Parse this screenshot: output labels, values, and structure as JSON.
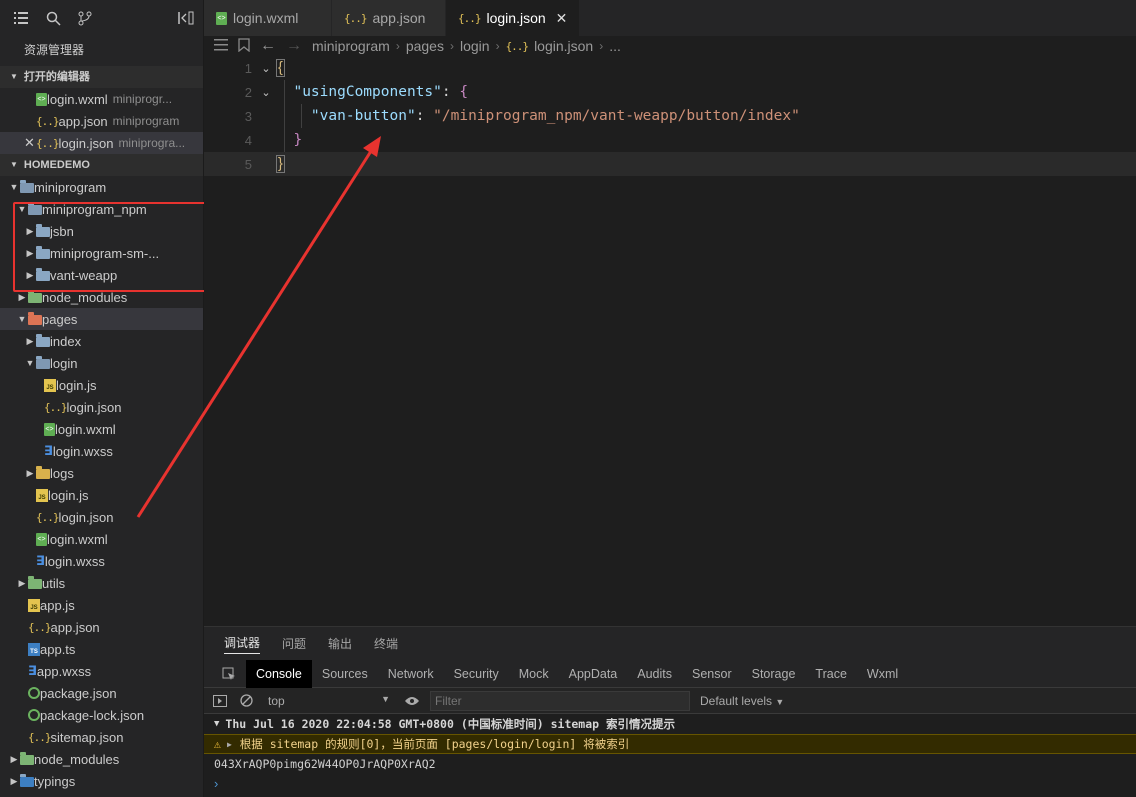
{
  "sidebar": {
    "title": "资源管理器",
    "open_editors": {
      "heading": "打开的编辑器",
      "items": [
        {
          "name": "login.wxml",
          "desc": "miniprogr...",
          "type": "wxml"
        },
        {
          "name": "app.json",
          "desc": "miniprogram",
          "type": "json"
        },
        {
          "name": "login.json",
          "desc": "miniprogra...",
          "type": "json",
          "active": true
        }
      ]
    },
    "project": {
      "heading": "HOMEDEMO",
      "tree": [
        {
          "label": "miniprogram",
          "depth": 1,
          "kind": "folder-open",
          "twisty": "open"
        },
        {
          "label": "miniprogram_npm",
          "depth": 2,
          "kind": "folder-open",
          "twisty": "open"
        },
        {
          "label": "jsbn",
          "depth": 3,
          "kind": "folder",
          "twisty": "closed"
        },
        {
          "label": "miniprogram-sm-...",
          "depth": 3,
          "kind": "folder",
          "twisty": "closed"
        },
        {
          "label": "vant-weapp",
          "depth": 3,
          "kind": "folder",
          "twisty": "closed"
        },
        {
          "label": "node_modules",
          "depth": 2,
          "kind": "folder-green",
          "twisty": "closed"
        },
        {
          "label": "pages",
          "depth": 2,
          "kind": "folder-pages",
          "twisty": "open",
          "selected": true
        },
        {
          "label": "index",
          "depth": 3,
          "kind": "folder",
          "twisty": "closed"
        },
        {
          "label": "login",
          "depth": 3,
          "kind": "folder-open",
          "twisty": "open"
        },
        {
          "label": "login.js",
          "depth": 4,
          "kind": "js"
        },
        {
          "label": "login.json",
          "depth": 4,
          "kind": "json"
        },
        {
          "label": "login.wxml",
          "depth": 4,
          "kind": "wxml"
        },
        {
          "label": "login.wxss",
          "depth": 4,
          "kind": "wxss"
        },
        {
          "label": "logs",
          "depth": 3,
          "kind": "folder-logs",
          "twisty": "closed"
        },
        {
          "label": "login.js",
          "depth": 3,
          "kind": "js"
        },
        {
          "label": "login.json",
          "depth": 3,
          "kind": "json"
        },
        {
          "label": "login.wxml",
          "depth": 3,
          "kind": "wxml"
        },
        {
          "label": "login.wxss",
          "depth": 3,
          "kind": "wxss"
        },
        {
          "label": "utils",
          "depth": 2,
          "kind": "folder-green",
          "twisty": "closed"
        },
        {
          "label": "app.js",
          "depth": 2,
          "kind": "js"
        },
        {
          "label": "app.json",
          "depth": 2,
          "kind": "json"
        },
        {
          "label": "app.ts",
          "depth": 2,
          "kind": "ts"
        },
        {
          "label": "app.wxss",
          "depth": 2,
          "kind": "wxss"
        },
        {
          "label": "package.json",
          "depth": 2,
          "kind": "pkg"
        },
        {
          "label": "package-lock.json",
          "depth": 2,
          "kind": "pkg"
        },
        {
          "label": "sitemap.json",
          "depth": 2,
          "kind": "json"
        },
        {
          "label": "node_modules",
          "depth": 1,
          "kind": "folder-green",
          "twisty": "closed"
        },
        {
          "label": "typings",
          "depth": 1,
          "kind": "folder-ts",
          "twisty": "closed"
        }
      ]
    }
  },
  "tabs": [
    {
      "label": "login.wxml",
      "type": "wxml"
    },
    {
      "label": "app.json",
      "type": "json"
    },
    {
      "label": "login.json",
      "type": "json",
      "active": true
    }
  ],
  "breadcrumb": [
    "miniprogram",
    "pages",
    "login",
    "login.json",
    "..."
  ],
  "code": {
    "line_numbers": [
      "1",
      "2",
      "3",
      "4",
      "5"
    ],
    "key_using": "\"usingComponents\"",
    "key_van": "\"van-button\"",
    "value_van": "\"/miniprogram_npm/vant-weapp/button/index\""
  },
  "panel": {
    "tabs": [
      "调试器",
      "问题",
      "输出",
      "终端"
    ],
    "devtools_tabs": [
      "Console",
      "Sources",
      "Network",
      "Security",
      "Mock",
      "AppData",
      "Audits",
      "Sensor",
      "Storage",
      "Trace",
      "Wxml"
    ],
    "context": "top",
    "filter_placeholder": "Filter",
    "levels": "Default levels",
    "log_header": "Thu Jul 16 2020 22:04:58 GMT+0800 (中国标准时间) sitemap 索引情况提示",
    "log_warning": "根据 sitemap 的规则[0]，当前页面 [pages/login/login] 将被索引",
    "log_plain": "043XrAQP0pimg62W44OP0JrAQP0XrAQ2",
    "prompt": "›"
  },
  "colors": {
    "highlight_box": "#e8332f",
    "arrow": "#e8332f"
  }
}
